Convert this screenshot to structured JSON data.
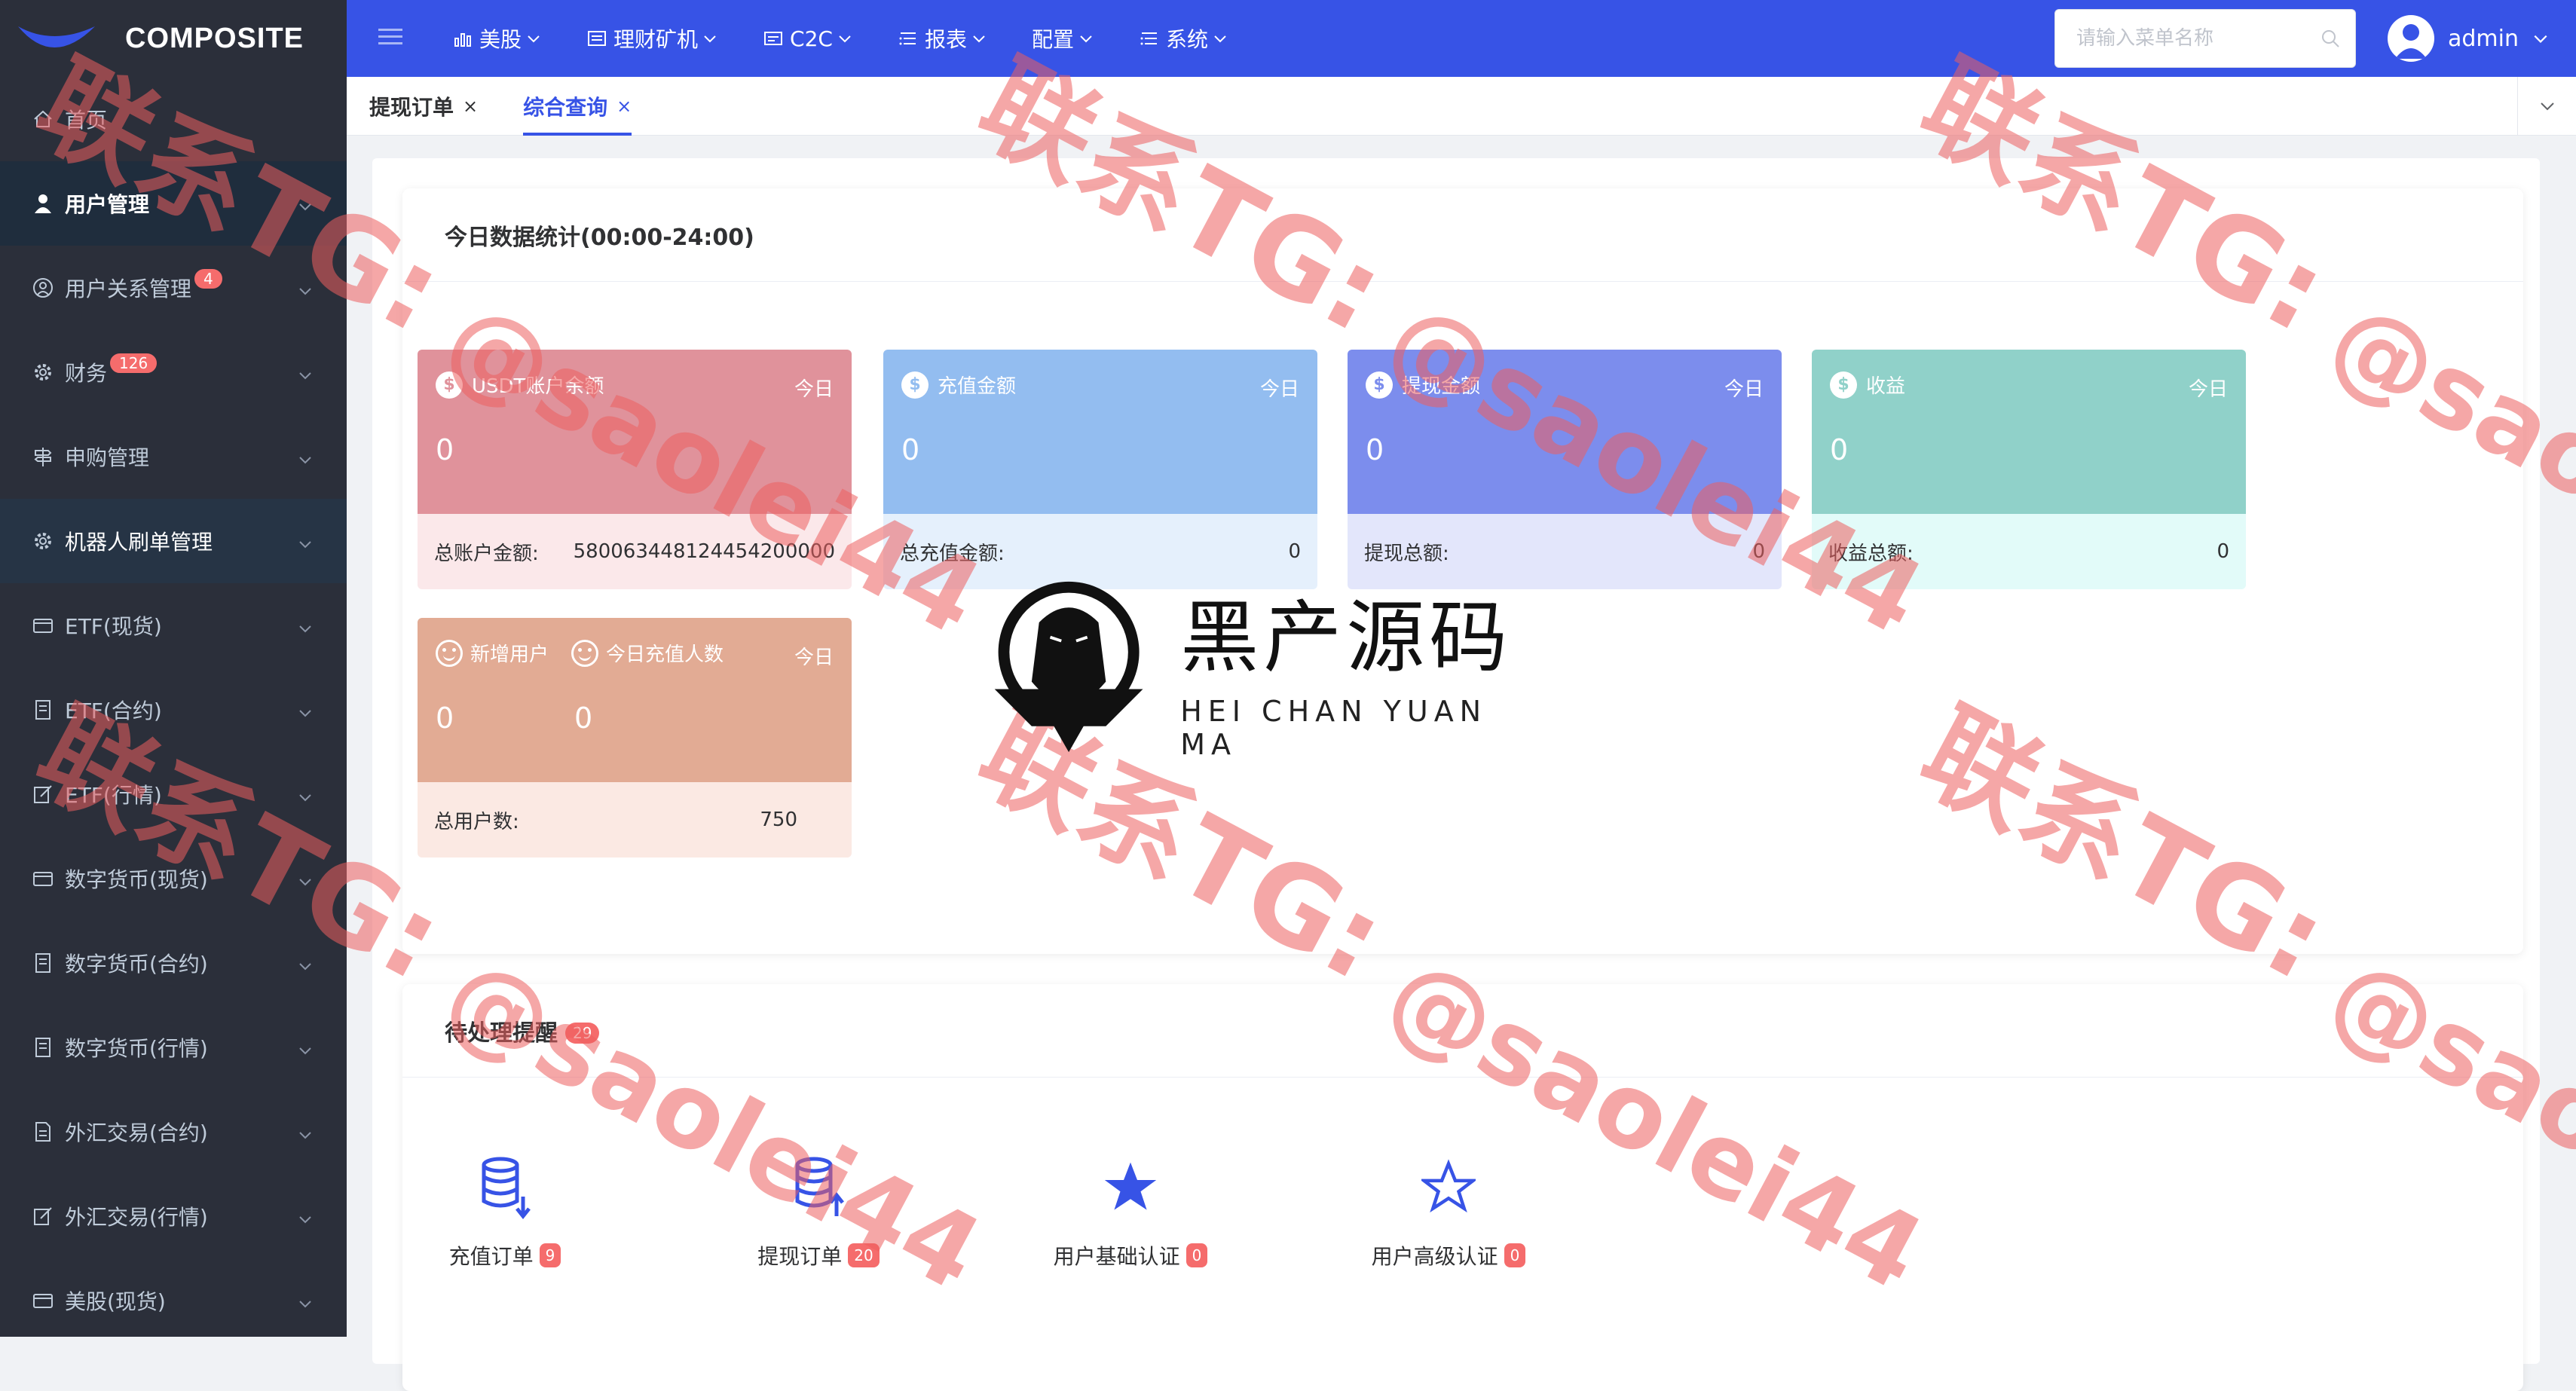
{
  "app": {
    "logo_text": "COMPOSITE"
  },
  "sidebar": {
    "items": [
      {
        "label": "首页",
        "icon": "home-icon",
        "badge": "",
        "state": "normal",
        "has_arrow": false
      },
      {
        "label": "用户管理",
        "icon": "user-icon",
        "badge": "",
        "state": "active",
        "has_arrow": true
      },
      {
        "label": "用户关系管理",
        "icon": "user-circle-icon",
        "badge": "4",
        "state": "normal",
        "has_arrow": true
      },
      {
        "label": "财务",
        "icon": "gear-icon",
        "badge": "126",
        "state": "normal",
        "has_arrow": true
      },
      {
        "label": "申购管理",
        "icon": "signpost-icon",
        "badge": "",
        "state": "normal",
        "has_arrow": true
      },
      {
        "label": "机器人刷单管理",
        "icon": "gear-icon",
        "badge": "",
        "state": "open",
        "has_arrow": true
      },
      {
        "label": "ETF(现货)",
        "icon": "wallet-icon",
        "badge": "",
        "state": "normal",
        "has_arrow": true
      },
      {
        "label": "ETF(合约)",
        "icon": "document-icon",
        "badge": "",
        "state": "normal",
        "has_arrow": true
      },
      {
        "label": "ETF(行情)",
        "icon": "edit-icon",
        "badge": "",
        "state": "normal",
        "has_arrow": true
      },
      {
        "label": "数字货币(现货)",
        "icon": "wallet-icon",
        "badge": "",
        "state": "normal",
        "has_arrow": true
      },
      {
        "label": "数字货币(合约)",
        "icon": "document-icon",
        "badge": "",
        "state": "normal",
        "has_arrow": true
      },
      {
        "label": "数字货币(行情)",
        "icon": "document-icon",
        "badge": "",
        "state": "normal",
        "has_arrow": true
      },
      {
        "label": "外汇交易(合约)",
        "icon": "file-icon",
        "badge": "",
        "state": "normal",
        "has_arrow": true
      },
      {
        "label": "外汇交易(行情)",
        "icon": "edit-icon",
        "badge": "",
        "state": "normal",
        "has_arrow": true
      },
      {
        "label": "美股(现货)",
        "icon": "wallet-icon",
        "badge": "",
        "state": "normal",
        "has_arrow": true
      }
    ]
  },
  "topnav": {
    "items": [
      {
        "label": "美股",
        "icon": "bar-chart-icon"
      },
      {
        "label": "理财矿机",
        "icon": "table-icon"
      },
      {
        "label": "C2C",
        "icon": "card-icon"
      },
      {
        "label": "报表",
        "icon": "list-icon"
      },
      {
        "label": "配置",
        "icon": "gear-icon"
      },
      {
        "label": "系统",
        "icon": "list-icon"
      }
    ],
    "search_placeholder": "请输入菜单名称",
    "username": "admin"
  },
  "tabs": [
    {
      "label": "提现订单",
      "active": false
    },
    {
      "label": "综合查询",
      "active": true
    }
  ],
  "today_stats": {
    "title": "今日数据统计(00:00-24:00)",
    "today_label": "今日",
    "cards": [
      {
        "title": "USDT账户余额",
        "value": "0",
        "footer_label": "总账户金额:",
        "footer_value": "580063448124454200000",
        "color": "#e0929b",
        "footer_bg": "#fbe8ea"
      },
      {
        "title": "充值金额",
        "value": "0",
        "footer_label": "总充值金额:",
        "footer_value": "0",
        "color": "#93bdf0",
        "footer_bg": "#e5f0fc"
      },
      {
        "title": "提现金额",
        "value": "0",
        "footer_label": "提现总额:",
        "footer_value": "0",
        "color": "#7c8ded",
        "footer_bg": "#e3e6fb"
      },
      {
        "title": "收益",
        "value": "0",
        "footer_label": "收益总额:",
        "footer_value": "0",
        "color": "#90d1c9",
        "footer_bg": "#e2fbf9"
      }
    ],
    "users_card": {
      "title_a": "新增用户",
      "title_b": "今日充值人数",
      "value_a": "0",
      "value_b": "0",
      "footer_label": "总用户数:",
      "footer_value": "750",
      "color": "#e2ab94",
      "footer_bg": "#fbe9e3"
    }
  },
  "reminders": {
    "title": "待处理提醒",
    "count": "29",
    "items": [
      {
        "label": "充值订单",
        "badge": "9",
        "icon": "database-download-icon"
      },
      {
        "label": "提现订单",
        "badge": "20",
        "icon": "database-upload-icon"
      },
      {
        "label": "用户基础认证",
        "badge": "0",
        "icon": "star-filled-icon"
      },
      {
        "label": "用户高级认证",
        "badge": "0",
        "icon": "star-outline-icon"
      }
    ]
  },
  "overlay": {
    "logo_cn": "黑产源码",
    "logo_en": "HEI CHAN YUAN MA",
    "watermark_a": "联系TG:",
    "watermark_b": "@saolei44"
  },
  "colors": {
    "accent": "#3753e6",
    "sidebar_bg": "#2b2f3a",
    "badge": "#f56c6c"
  }
}
